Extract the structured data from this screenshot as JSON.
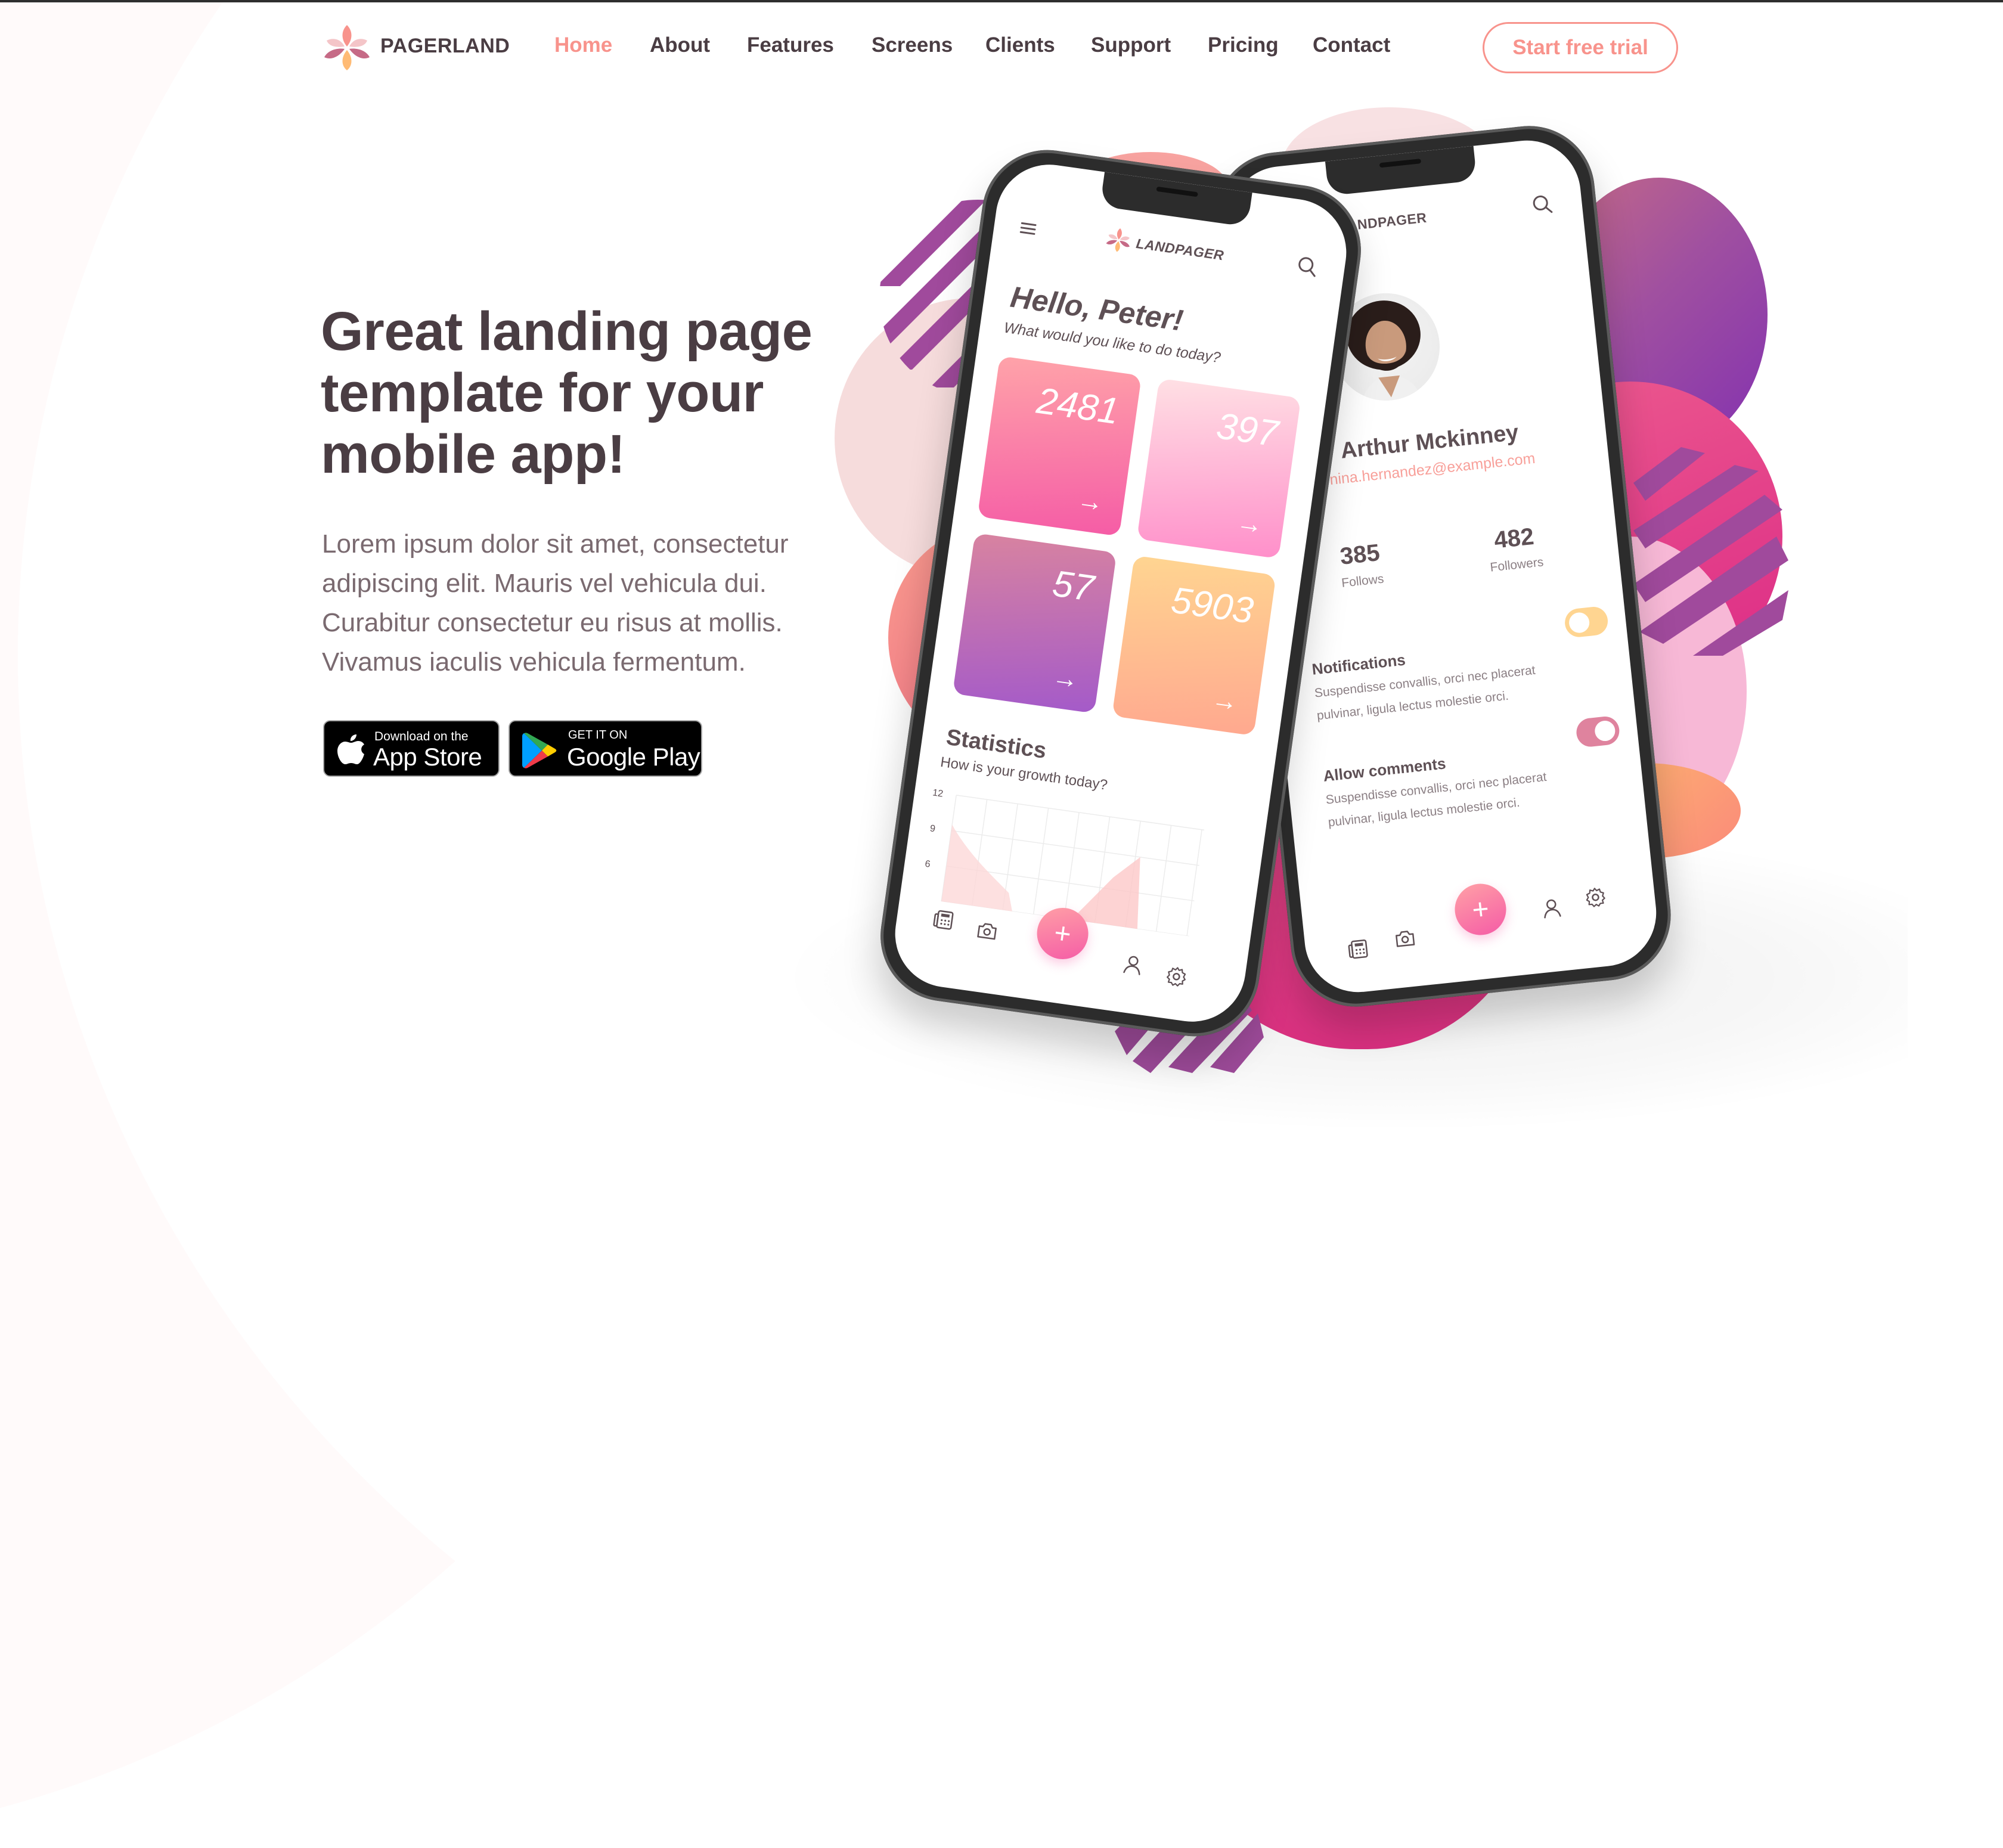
{
  "header": {
    "brand": "PAGERLAND",
    "nav": [
      {
        "label": "Home",
        "active": true
      },
      {
        "label": "About",
        "active": false
      },
      {
        "label": "Features",
        "active": false
      },
      {
        "label": "Screens",
        "active": false
      },
      {
        "label": "Clients",
        "active": false
      },
      {
        "label": "Support",
        "active": false
      },
      {
        "label": "Pricing",
        "active": false
      },
      {
        "label": "Contact",
        "active": false
      }
    ],
    "cta_label": "Start free trial"
  },
  "hero": {
    "headline_lines": [
      "Great landing page",
      "template for your",
      "mobile app!"
    ],
    "lead_lines": [
      "Lorem ipsum dolor sit amet, consectetur",
      "adipiscing elit. Mauris vel vehicula dui.",
      "Curabitur consectetur eu risus at mollis.",
      "Vivamus iaculis vehicula fermentum."
    ],
    "app_store": {
      "small": "Download on the",
      "big": "App Store"
    },
    "google_play": {
      "small": "GET IT ON",
      "big": "Google Play"
    }
  },
  "phone_left": {
    "brand": "LANDPAGER",
    "greeting": "Hello, Peter!",
    "greeting_sub": "What would you like to do today?",
    "tiles": [
      {
        "value": "2481",
        "arrow": "→"
      },
      {
        "value": "397",
        "arrow": "→"
      },
      {
        "value": "57",
        "arrow": "→"
      },
      {
        "value": "5903",
        "arrow": "→"
      }
    ],
    "stats_title": "Statistics",
    "stats_sub": "How is your growth today?",
    "chart_ticks": [
      "12",
      "9",
      "6"
    ],
    "fab_label": "+"
  },
  "phone_right": {
    "brand": "LANDPAGER",
    "name": "Arthur Mckinney",
    "email": "nina.hernandez@example.com",
    "stats": [
      {
        "value": "385",
        "label": "Follows"
      },
      {
        "value": "482",
        "label": "Followers"
      }
    ],
    "settings": [
      {
        "title": "Notifications",
        "desc_lines": [
          "Suspendisse convallis, orci nec placerat",
          "pulvinar, ligula lectus molestie orci."
        ],
        "toggle_on": false
      },
      {
        "title": "Allow comments",
        "desc_lines": [
          "Suspendisse convallis, orci nec placerat",
          "pulvinar, ligula lectus molestie orci."
        ],
        "toggle_on": true
      }
    ],
    "fab_label": "+"
  },
  "colors": {
    "accent": "#f8938c",
    "text_dark": "#4a3d43",
    "text_muted": "#7a6a70",
    "toggle_off": "#ffd591",
    "toggle_on": "#df839e",
    "tile_pink": "#f55ca6",
    "tile_light_pink": "#ff9ccf",
    "tile_purple": "#a45ac9",
    "tile_peach": "#ffae8f"
  }
}
